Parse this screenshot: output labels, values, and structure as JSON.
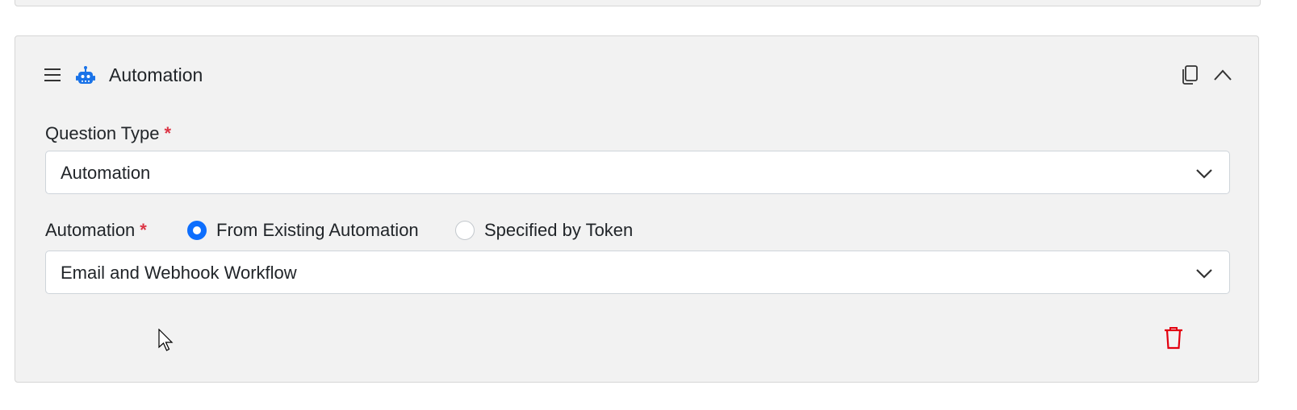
{
  "card": {
    "title": "Automation",
    "icons": {
      "drag": "hamburger-icon",
      "type": "robot-icon",
      "copy": "copy-icon",
      "collapse": "chevron-up-icon",
      "delete": "trash-icon"
    }
  },
  "question_type": {
    "label": "Question Type",
    "required_mark": "*",
    "value": "Automation"
  },
  "automation": {
    "label": "Automation",
    "required_mark": "*",
    "source_options": [
      {
        "label": "From Existing Automation",
        "selected": true
      },
      {
        "label": "Specified by Token",
        "selected": false
      }
    ],
    "value": "Email and Webhook Workflow"
  },
  "colors": {
    "accent": "#0d6efd",
    "required": "#dc3545",
    "delete": "#e3000f",
    "robot": "#1a73e8",
    "card_bg": "#f2f2f2"
  }
}
